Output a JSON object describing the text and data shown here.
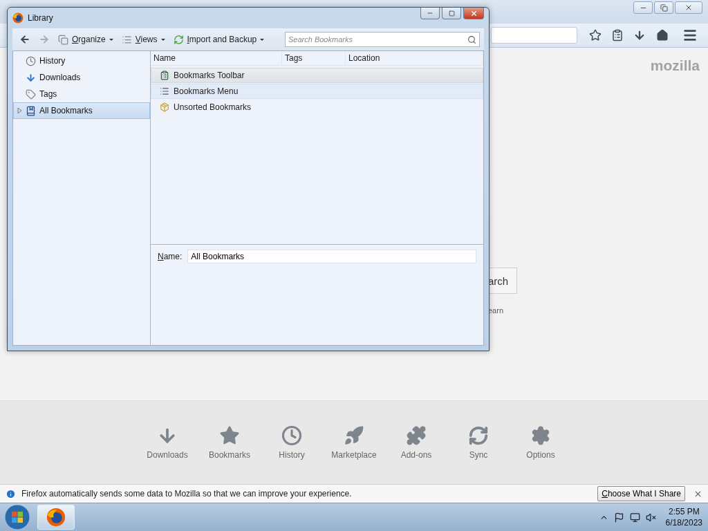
{
  "browser": {
    "brand": "mozilla",
    "search_button": "arch",
    "search_hint": "earn",
    "launcher": [
      {
        "label": "Downloads",
        "kind": "downloads"
      },
      {
        "label": "Bookmarks",
        "kind": "bookmarks"
      },
      {
        "label": "History",
        "kind": "history"
      },
      {
        "label": "Marketplace",
        "kind": "marketplace"
      },
      {
        "label": "Add-ons",
        "kind": "addons"
      },
      {
        "label": "Sync",
        "kind": "sync"
      },
      {
        "label": "Options",
        "kind": "options"
      }
    ],
    "notification": {
      "text": "Firefox automatically sends some data to Mozilla so that we can improve your experience.",
      "button": "Choose What I Share"
    }
  },
  "library": {
    "title": "Library",
    "toolbar": {
      "organize": "Organize",
      "views": "Views",
      "import": "Import and Backup",
      "search_placeholder": "Search Bookmarks"
    },
    "sidebar": [
      {
        "label": "History",
        "kind": "history",
        "selected": false
      },
      {
        "label": "Downloads",
        "kind": "downloads",
        "selected": false
      },
      {
        "label": "Tags",
        "kind": "tags",
        "selected": false
      },
      {
        "label": "All Bookmarks",
        "kind": "bookmarks",
        "selected": true,
        "expanded": false
      }
    ],
    "columns": [
      "Name",
      "Tags",
      "Location"
    ],
    "rows": [
      {
        "name": "Bookmarks Toolbar",
        "kind": "toolbar",
        "selected": true,
        "hovered": false
      },
      {
        "name": "Bookmarks Menu",
        "kind": "menu",
        "selected": false,
        "hovered": true
      },
      {
        "name": "Unsorted Bookmarks",
        "kind": "unsorted",
        "selected": false,
        "hovered": false
      }
    ],
    "details": {
      "label": "Name:",
      "value": "All Bookmarks"
    }
  },
  "taskbar": {
    "time": "2:55 PM",
    "date": "6/18/2023"
  }
}
